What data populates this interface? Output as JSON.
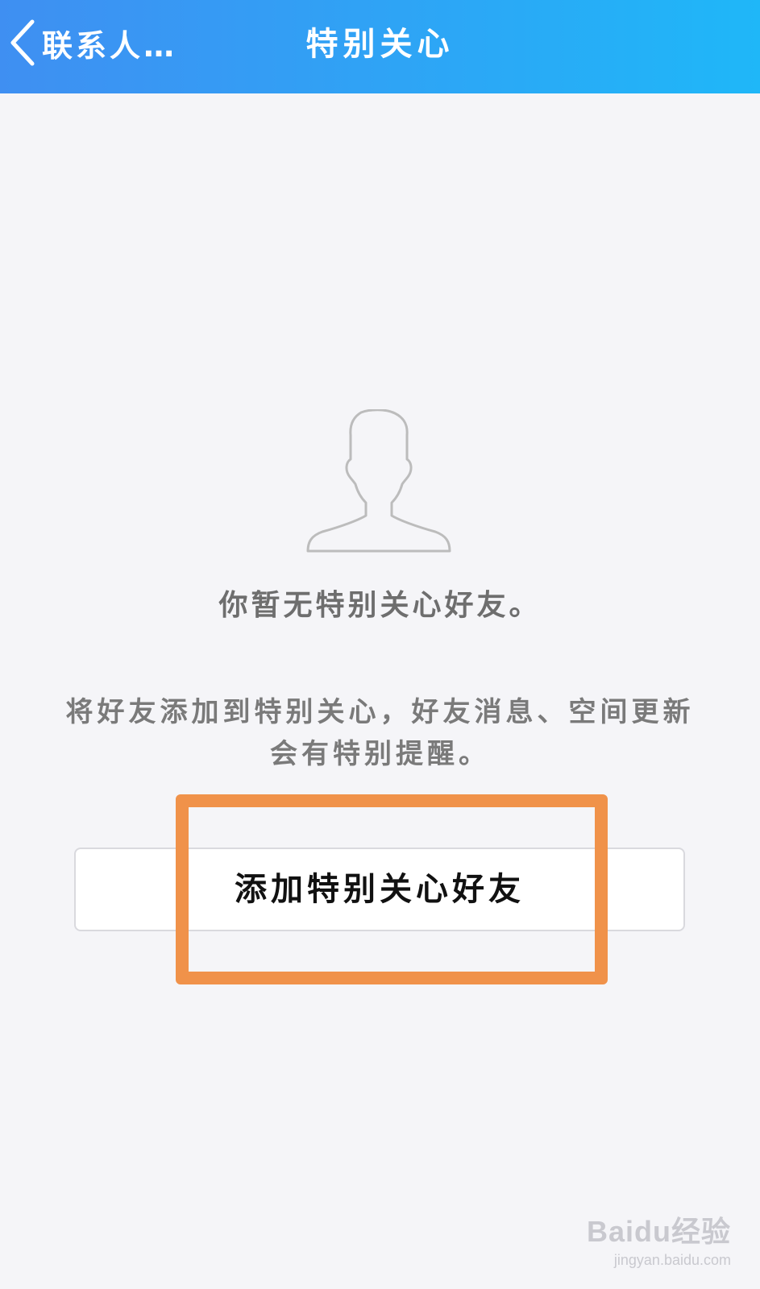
{
  "header": {
    "back_label": "联系人…",
    "title": "特别关心"
  },
  "empty_state": {
    "title": "你暂无特别关心好友。",
    "hint_line1": "将好友添加到特别关心，好友消息、空间更新",
    "hint_line2": "会有特别提醒。",
    "button_label": "添加特别关心好友"
  },
  "watermark": {
    "logo": "Baidu经验",
    "url": "jingyan.baidu.com"
  },
  "colors": {
    "header_start": "#3f8ff2",
    "header_end": "#1fb7f8",
    "highlight": "#f0924a",
    "background": "#f5f5f8"
  },
  "icons": {
    "back": "chevron-left-icon",
    "avatar": "user-silhouette-icon",
    "watermark_paw": "paw-icon"
  }
}
